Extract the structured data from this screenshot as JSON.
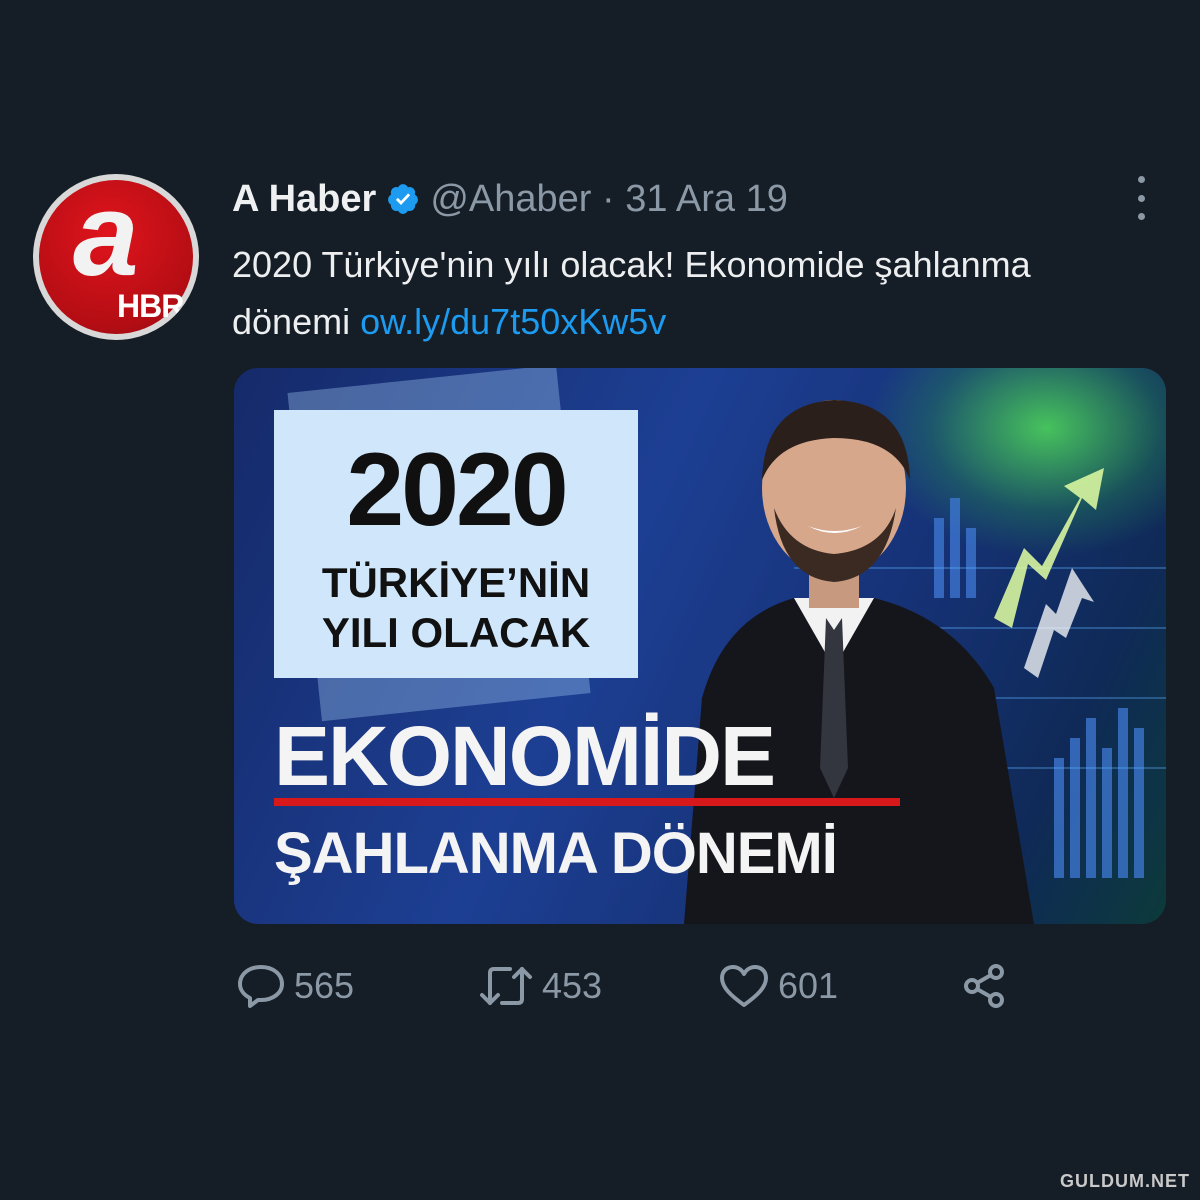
{
  "tweet": {
    "author_name": "A Haber",
    "handle_date": "@Ahaber · 31 Ara 19",
    "text": "2020 Türkiye'nin yılı olacak! Ekonomide şahlanma dönemi",
    "link": "ow.ly/du7t50xKw5v"
  },
  "avatar": {
    "letter": "a",
    "label": "HBR"
  },
  "media": {
    "year": "2020",
    "line1": "TÜRKİYE’NİN",
    "line2": "YILI OLACAK",
    "headline": "EKONOMİDE",
    "subheadline": "ŞAHLANMA DÖNEMİ"
  },
  "actions": {
    "replies": "565",
    "retweets": "453",
    "likes": "601"
  },
  "watermark": "GULDUM.NET",
  "colors": {
    "background": "#151d26",
    "link": "#1d9bf0",
    "muted": "#8b98a5",
    "accent_red": "#d8191c"
  },
  "icons": [
    "verified-badge-icon",
    "more-icon",
    "reply-icon",
    "retweet-icon",
    "like-icon",
    "share-icon"
  ]
}
